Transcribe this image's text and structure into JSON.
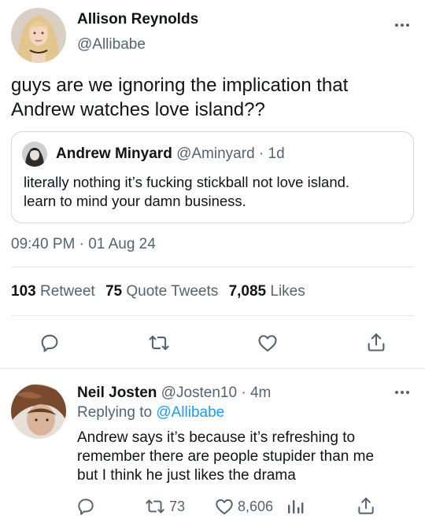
{
  "tweet": {
    "author_name": "Allison Reynolds",
    "author_handle": "@Allibabe",
    "text_line1": "guys are we ignoring the implication that",
    "text_line2": "Andrew watches love island??",
    "quote": {
      "author_name": "Andrew Minyard",
      "author_handle": "@Aminyard",
      "separator": "·",
      "time": "1d",
      "text_line1": "literally nothing it’s fucking stickball not love island.",
      "text_line2": "learn to mind your damn business."
    },
    "time": "09:40 PM",
    "separator": "·",
    "date": "01 Aug 24",
    "stats": {
      "retweets_count": "103",
      "retweets_label": "Retweet",
      "quotes_count": "75",
      "quotes_label": "Quote Tweets",
      "likes_count": "7,085",
      "likes_label": "Likes"
    }
  },
  "reply": {
    "author_name": "Neil Josten",
    "author_handle": "@Josten10",
    "separator": "·",
    "time": "4m",
    "replying_to_label": "Replying to",
    "replying_to_handle": "@Allibabe",
    "text_line1": "Andrew says it’s because it’s refreshing to",
    "text_line2": "remember there are people stupider than me",
    "text_line3": "but I think he just likes the drama",
    "retweets": "73",
    "likes": "8,606"
  },
  "colors": {
    "accent": "#1d9bf0",
    "muted": "#536471",
    "border": "#e3e7ea"
  },
  "icons": [
    "reply-icon",
    "retweet-icon",
    "like-icon",
    "share-icon",
    "analytics-icon",
    "more-icon"
  ]
}
